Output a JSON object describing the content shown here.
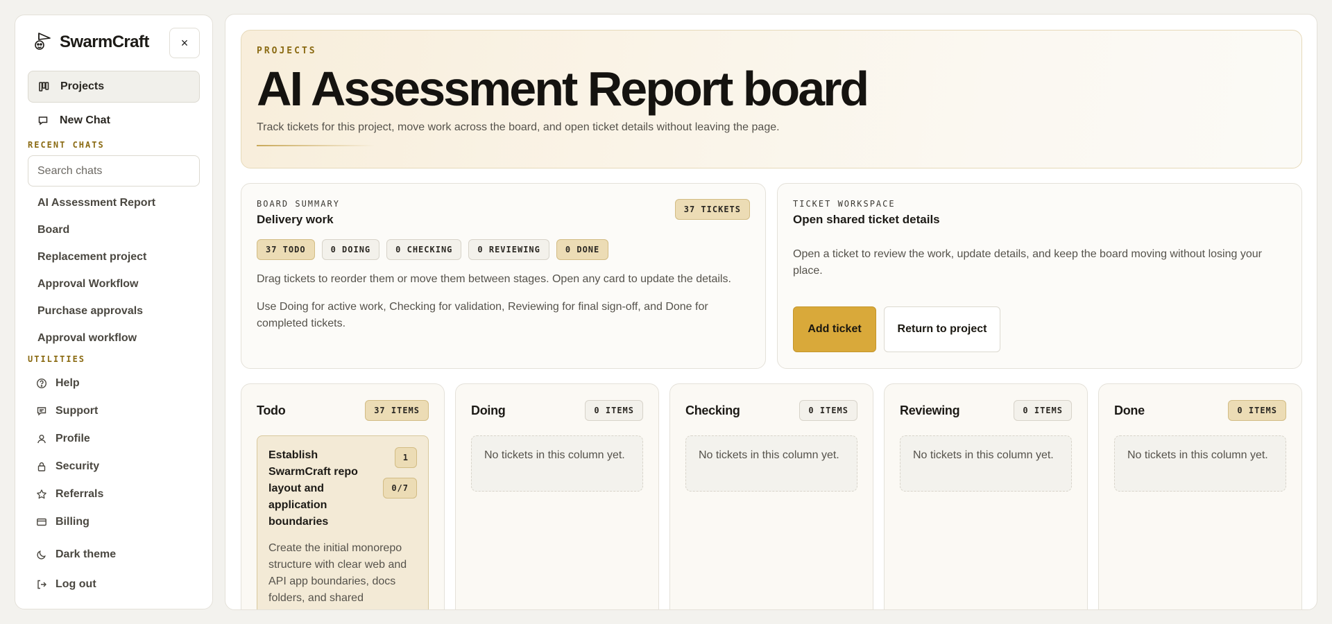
{
  "sidebar": {
    "brand": "SwarmCraft",
    "close_label": "×",
    "nav": {
      "projects": "Projects",
      "new_chat": "New Chat"
    },
    "recent_label": "RECENT CHATS",
    "search_placeholder": "Search chats",
    "chats": [
      "AI Assessment Report",
      "Board",
      "Replacement project",
      "Approval Workflow",
      "Purchase approvals",
      "Approval workflow"
    ],
    "utilities_label": "UTILITIES",
    "utilities": {
      "help": "Help",
      "support": "Support",
      "profile": "Profile",
      "security": "Security",
      "referrals": "Referrals",
      "billing": "Billing",
      "theme": "Dark theme",
      "logout": "Log out"
    }
  },
  "hero": {
    "eyebrow": "PROJECTS",
    "title": "AI Assessment Report board",
    "subtitle": "Track tickets for this project, move work across the board, and open ticket details without leaving the page."
  },
  "summary": {
    "eyebrow": "BOARD SUMMARY",
    "title": "Delivery work",
    "ticket_count": "37 TICKETS",
    "stage_pills": [
      "37 TODO",
      "0 DOING",
      "0 CHECKING",
      "0 REVIEWING",
      "0 DONE"
    ],
    "text1": "Drag tickets to reorder them or move them between stages. Open any card to update the details.",
    "text2": "Use Doing for active work, Checking for validation, Reviewing for final sign-off, and Done for completed tickets."
  },
  "workspace": {
    "eyebrow": "TICKET WORKSPACE",
    "title": "Open shared ticket details",
    "text": "Open a ticket to review the work, update details, and keep the board moving without losing your place.",
    "add_label": "Add ticket",
    "return_label": "Return to project"
  },
  "columns": [
    {
      "title": "Todo",
      "count": "37 ITEMS"
    },
    {
      "title": "Doing",
      "count": "0 ITEMS",
      "empty": "No tickets in this column yet."
    },
    {
      "title": "Checking",
      "count": "0 ITEMS",
      "empty": "No tickets in this column yet."
    },
    {
      "title": "Reviewing",
      "count": "0 ITEMS",
      "empty": "No tickets in this column yet."
    },
    {
      "title": "Done",
      "count": "0 ITEMS",
      "empty": "No tickets in this column yet."
    }
  ],
  "ticket": {
    "title": "Establish SwarmCraft repo layout and application boundaries",
    "number": "1",
    "progress": "0/7",
    "description": "Create the initial monorepo structure with clear web and API app boundaries, docs folders, and shared conventions for the"
  },
  "colors": {
    "accent": "#d9a93a",
    "eyebrow": "#8a6a12"
  }
}
